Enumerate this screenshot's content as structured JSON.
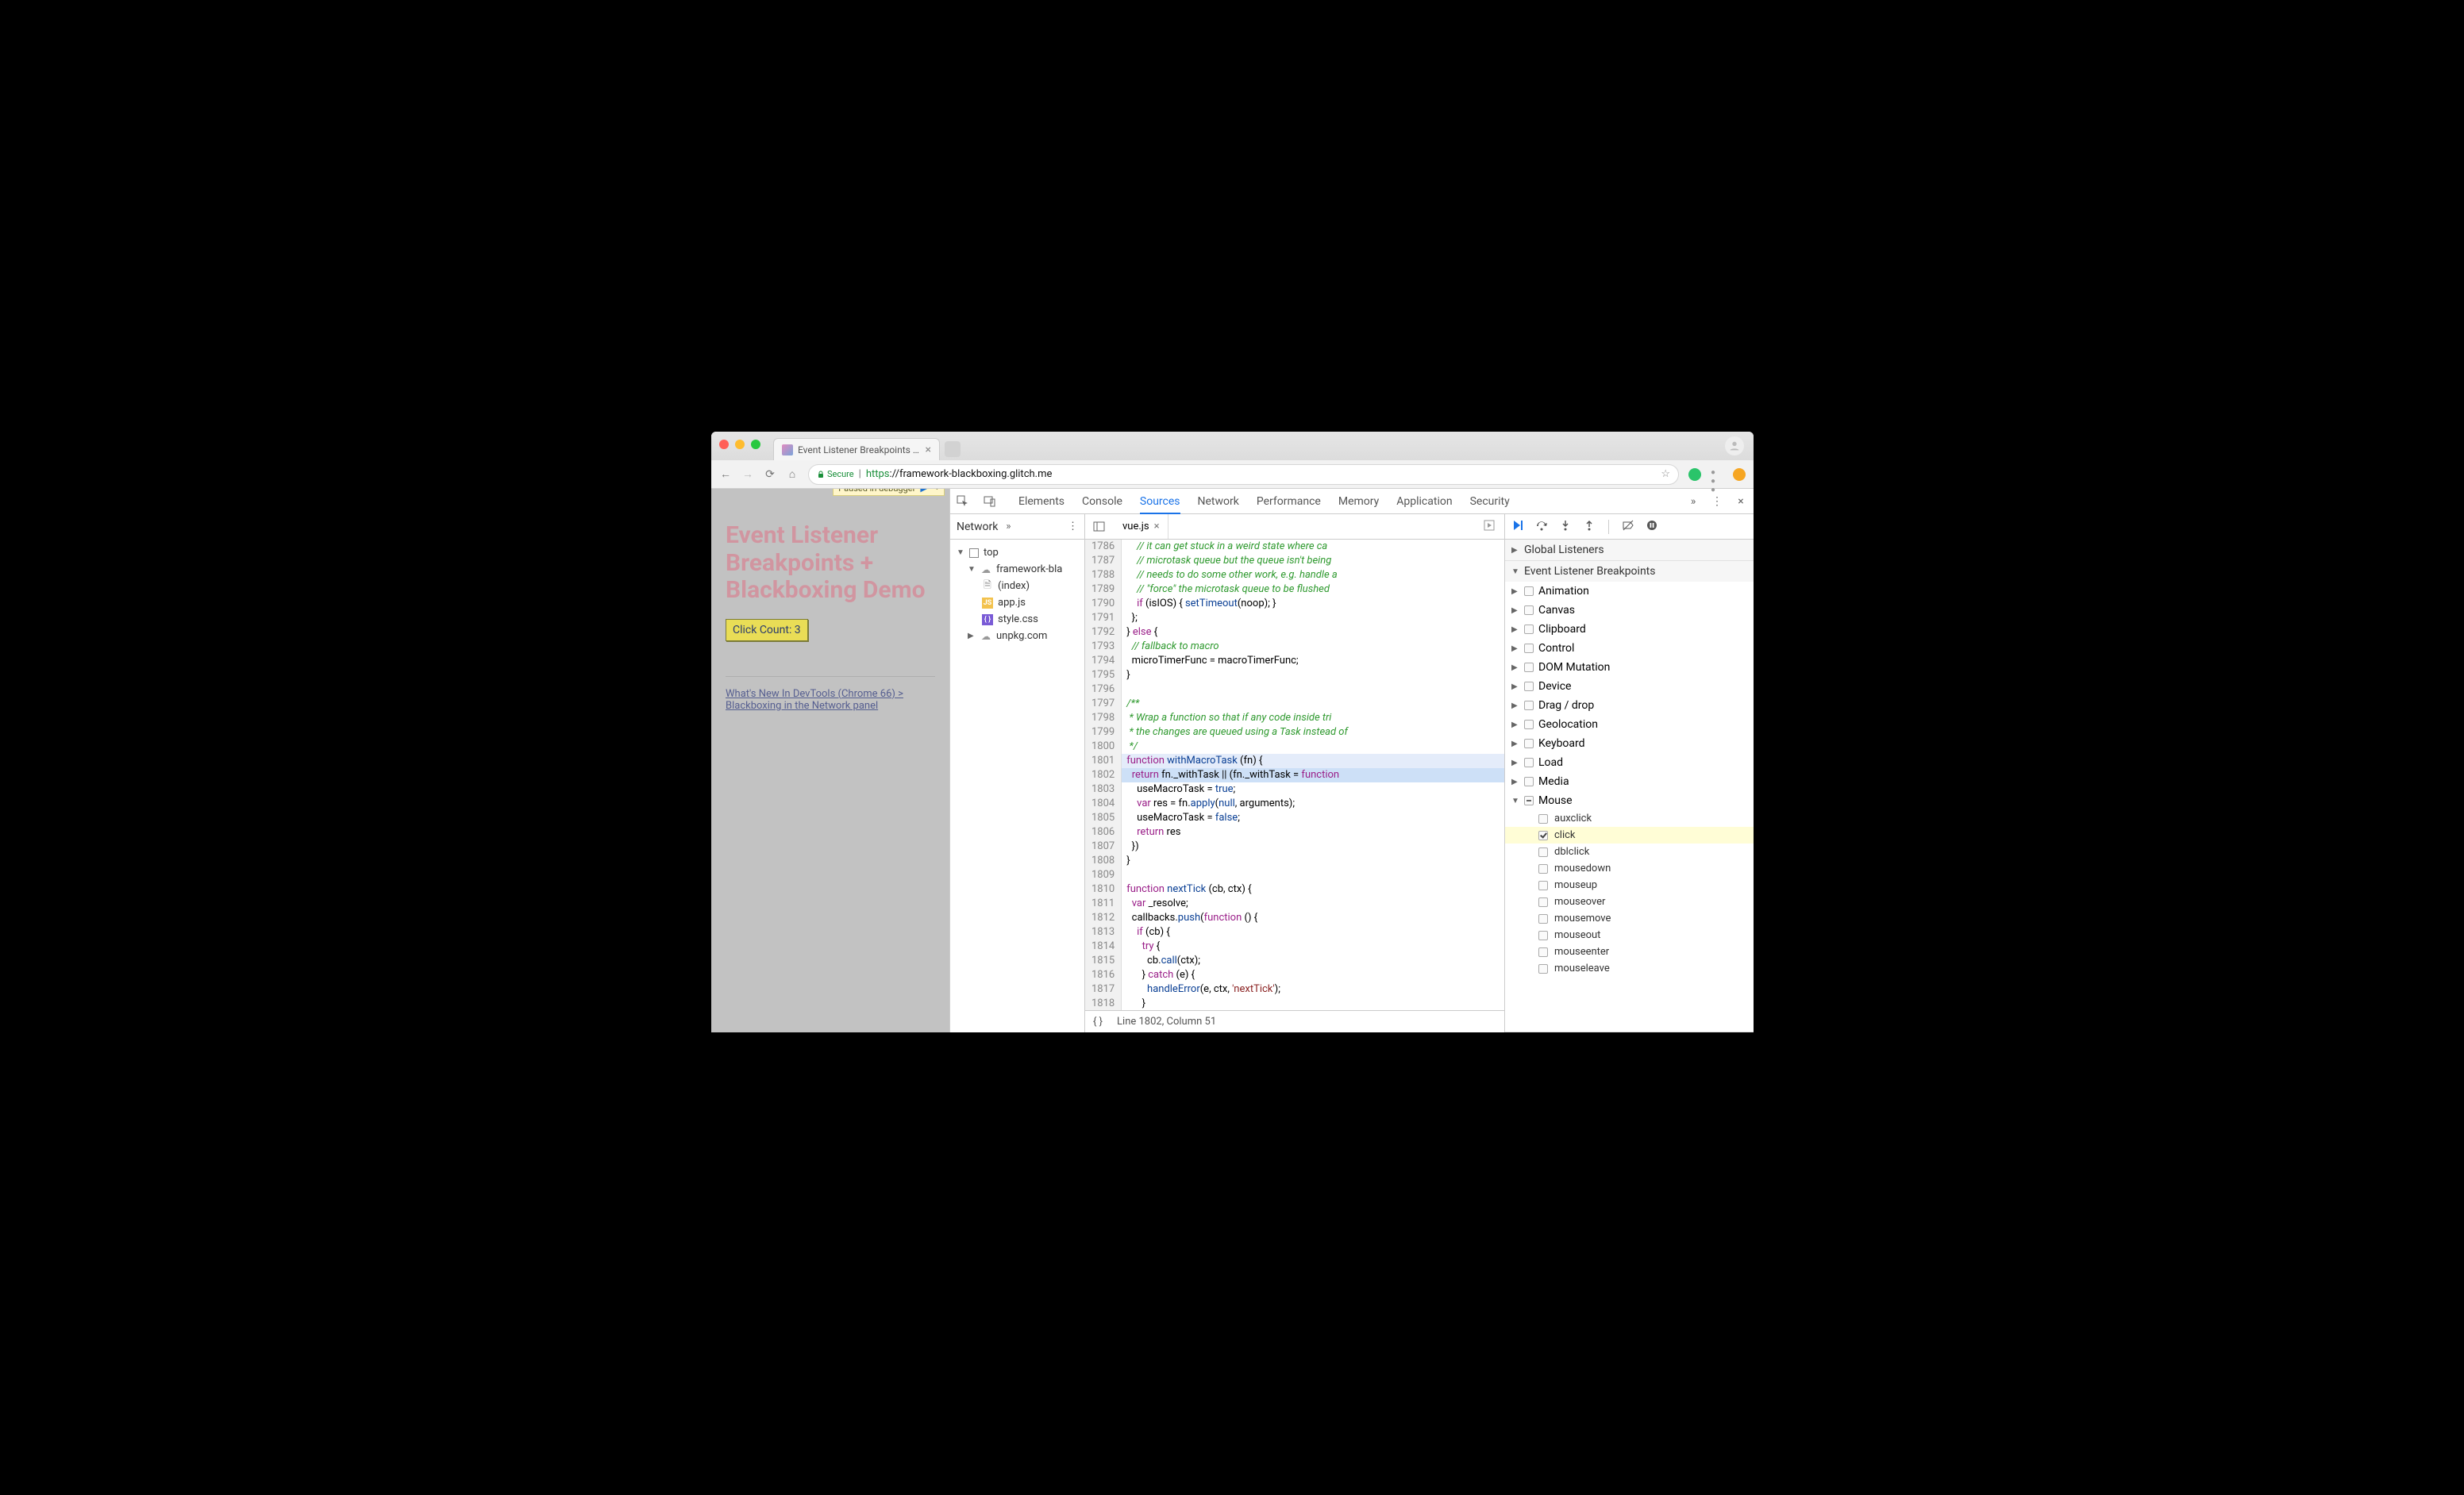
{
  "browser": {
    "tab_title": "Event Listener Breakpoints + B",
    "secure_label": "Secure",
    "url_scheme": "https",
    "url_host_path": "://framework-blackboxing.glitch.me"
  },
  "page": {
    "paused_label": "Paused in debugger",
    "heading1": "Event Listener",
    "heading2": "Breakpoints +",
    "heading3": "Blackboxing Demo",
    "click_btn": "Click Count: 3",
    "link_text": "What's New In DevTools (Chrome 66) > Blackboxing in the Network panel"
  },
  "devtools": {
    "tabs": [
      "Elements",
      "Console",
      "Sources",
      "Network",
      "Performance",
      "Memory",
      "Application",
      "Security"
    ],
    "active_tab_index": 2
  },
  "navigator": {
    "dropdown": "Network",
    "tree": {
      "top": "top",
      "domain": "framework-bla",
      "files": [
        "(index)",
        "app.js",
        "style.css"
      ],
      "other": "unpkg.com"
    }
  },
  "editor": {
    "filename": "vue.js",
    "status_line": 1802,
    "status_col": 51,
    "status_text_prefix": "Line ",
    "status_text_mid": ", Column ",
    "lines_start": 1786,
    "code": [
      {
        "n": 1786,
        "h": "    <span class='c'>// it can get stuck in a weird state where ca</span>"
      },
      {
        "n": 1787,
        "h": "    <span class='c'>// microtask queue but the queue isn't being</span>"
      },
      {
        "n": 1788,
        "h": "    <span class='c'>// needs to do some other work, e.g. handle a</span>"
      },
      {
        "n": 1789,
        "h": "    <span class='c'>// \"force\" the microtask queue to be flushed</span>"
      },
      {
        "n": 1790,
        "h": "    <span class='k'>if</span> (isIOS) { <span class='f'>setTimeout</span>(noop); }"
      },
      {
        "n": 1791,
        "h": "  };"
      },
      {
        "n": 1792,
        "h": "} <span class='k'>else</span> {"
      },
      {
        "n": 1793,
        "h": "  <span class='c'>// fallback to macro</span>"
      },
      {
        "n": 1794,
        "h": "  microTimerFunc = macroTimerFunc;"
      },
      {
        "n": 1795,
        "h": "}"
      },
      {
        "n": 1796,
        "h": ""
      },
      {
        "n": 1797,
        "h": "<span class='c'>/**</span>"
      },
      {
        "n": 1798,
        "h": "<span class='c'> * Wrap a function so that if any code inside tri</span>"
      },
      {
        "n": 1799,
        "h": "<span class='c'> * the changes are queued using a Task instead of</span>"
      },
      {
        "n": 1800,
        "h": "<span class='c'> */</span>"
      },
      {
        "n": 1801,
        "h": "<span class='k'>function</span> <span class='f'>withMacroTask</span> (fn) {",
        "cls": "hl-blue"
      },
      {
        "n": 1802,
        "h": "  <span class='k'>return</span> fn._withTask || (fn._withTask = <span class='k'>function</span>",
        "cls": "hl-exec"
      },
      {
        "n": 1803,
        "h": "    useMacroTask = <span class='b'>true</span>;"
      },
      {
        "n": 1804,
        "h": "    <span class='k'>var</span> res = fn.<span class='f'>apply</span>(<span class='b'>null</span>, arguments);"
      },
      {
        "n": 1805,
        "h": "    useMacroTask = <span class='b'>false</span>;"
      },
      {
        "n": 1806,
        "h": "    <span class='k'>return</span> res"
      },
      {
        "n": 1807,
        "h": "  })"
      },
      {
        "n": 1808,
        "h": "}"
      },
      {
        "n": 1809,
        "h": ""
      },
      {
        "n": 1810,
        "h": "<span class='k'>function</span> <span class='f'>nextTick</span> (cb, ctx) {"
      },
      {
        "n": 1811,
        "h": "  <span class='k'>var</span> _resolve;"
      },
      {
        "n": 1812,
        "h": "  callbacks.<span class='f'>push</span>(<span class='k'>function</span> () {"
      },
      {
        "n": 1813,
        "h": "    <span class='k'>if</span> (cb) {"
      },
      {
        "n": 1814,
        "h": "      <span class='k'>try</span> {"
      },
      {
        "n": 1815,
        "h": "        cb.<span class='f'>call</span>(ctx);"
      },
      {
        "n": 1816,
        "h": "      } <span class='k'>catch</span> (e) {"
      },
      {
        "n": 1817,
        "h": "        <span class='f'>handleError</span>(e, ctx, <span class='s'>'nextTick'</span>);"
      },
      {
        "n": 1818,
        "h": "      }"
      }
    ]
  },
  "debugger": {
    "sections": {
      "global": "Global Listeners",
      "elb": "Event Listener Breakpoints"
    },
    "categories": [
      "Animation",
      "Canvas",
      "Clipboard",
      "Control",
      "DOM Mutation",
      "Device",
      "Drag / drop",
      "Geolocation",
      "Keyboard",
      "Load",
      "Media",
      "Mouse"
    ],
    "mouse_events": [
      "auxclick",
      "click",
      "dblclick",
      "mousedown",
      "mouseup",
      "mouseover",
      "mousemove",
      "mouseout",
      "mouseenter",
      "mouseleave"
    ],
    "checked_event": "click"
  }
}
